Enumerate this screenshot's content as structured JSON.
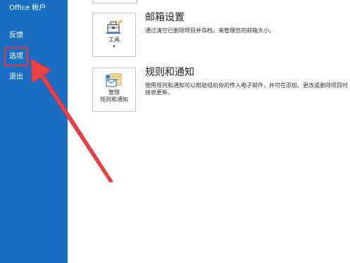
{
  "nav": {
    "items": [
      {
        "id": "account",
        "label": "Office 帐户"
      },
      {
        "id": "feedback",
        "label": "反馈"
      },
      {
        "id": "options",
        "label": "选项"
      },
      {
        "id": "exit",
        "label": "退出"
      }
    ]
  },
  "tools_section": {
    "title": "邮箱设置",
    "description": "通过清空已删除项目并存档，来管理您的邮箱大小。",
    "button_label": "工具",
    "button_chevron": "▾"
  },
  "rules_section": {
    "title": "规则和通知",
    "description": "使用规则和通知可以帮助组织你的传入电子邮件，并可在添加、更改或删除项目时接收更新。",
    "button_label_line1": "管理",
    "button_label_line2": "规则和通知"
  },
  "colors": {
    "nav_bg": "#1a6fc4",
    "highlight": "#e8343a",
    "arrow": "#ef4044"
  },
  "icons": {
    "tools": "toolbox-icon",
    "manage_rules": "rules-envelope-icon"
  }
}
